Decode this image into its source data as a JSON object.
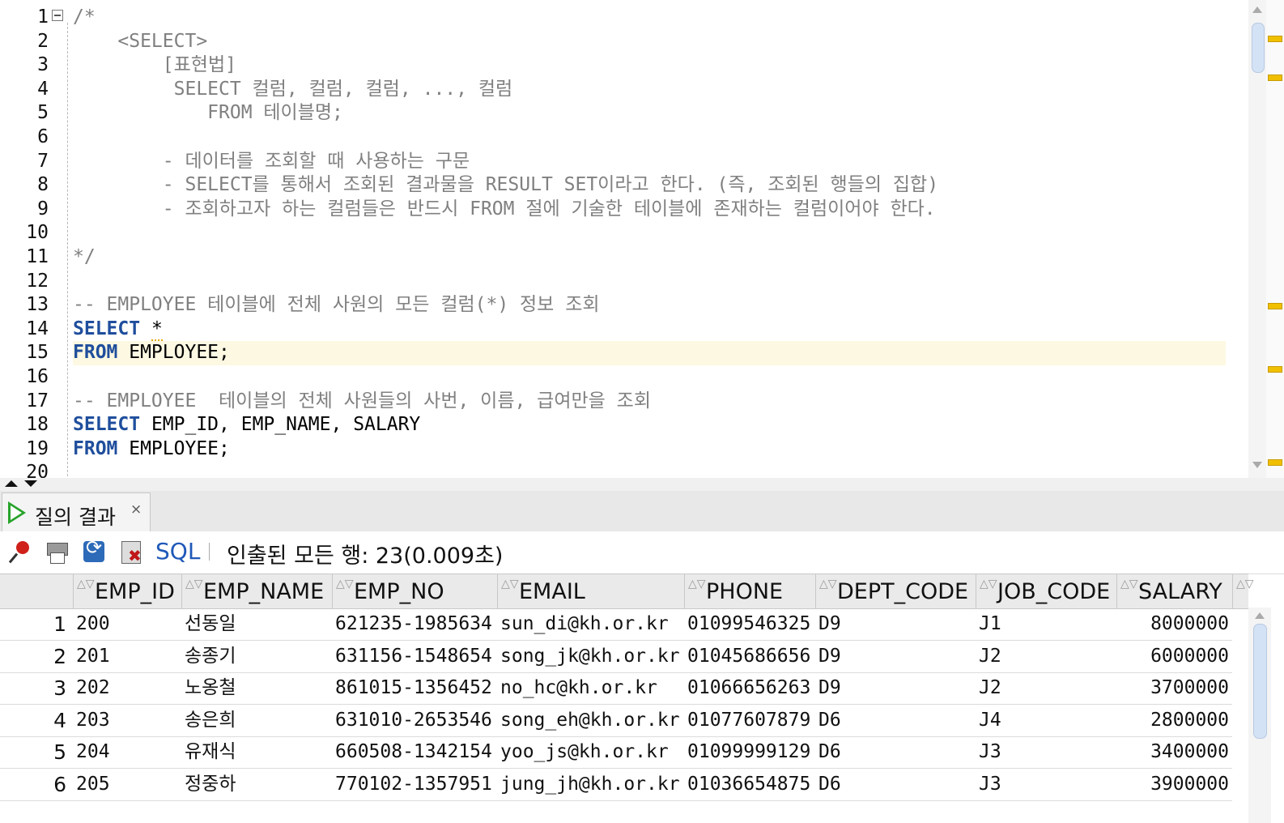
{
  "editor": {
    "line_numbers": [
      "1",
      "2",
      "3",
      "4",
      "5",
      "6",
      "7",
      "8",
      "9",
      "10",
      "11",
      "12",
      "13",
      "14",
      "15",
      "16",
      "17",
      "18",
      "19",
      "20"
    ],
    "lines": [
      [
        {
          "t": "/*",
          "c": "cm"
        }
      ],
      [
        {
          "t": "    <SELECT>",
          "c": "cm"
        }
      ],
      [
        {
          "t": "        [표현법]",
          "c": "cm"
        }
      ],
      [
        {
          "t": "         SELECT 컬럼, 컬럼, 컬럼, ..., 컬럼",
          "c": "cm"
        }
      ],
      [
        {
          "t": "            FROM 테이블명;",
          "c": "cm"
        }
      ],
      [],
      [
        {
          "t": "        - 데이터를 조회할 때 사용하는 구문",
          "c": "cm"
        }
      ],
      [
        {
          "t": "        - SELECT를 통해서 조회된 결과물을 RESULT SET이라고 한다. (즉, 조회된 행들의 집합)",
          "c": "cm"
        }
      ],
      [
        {
          "t": "        - 조회하고자 하는 컬럼들은 반드시 FROM 절에 기술한 테이블에 존재하는 컬럼이어야 한다.",
          "c": "cm"
        }
      ],
      [],
      [
        {
          "t": "*/",
          "c": "cm"
        }
      ],
      [],
      [
        {
          "t": "-- EMPLOYEE 테이블에 전체 사원의 모든 컬럼(*) 정보 조회",
          "c": "cm"
        }
      ],
      [
        {
          "t": "SELECT",
          "c": "kw"
        },
        {
          "t": " ",
          "c": "plain"
        },
        {
          "t": "*",
          "c": "squig"
        }
      ],
      [
        {
          "t": "FROM",
          "c": "kw"
        },
        {
          "t": " EMPLOYEE;",
          "c": "plain"
        }
      ],
      [],
      [
        {
          "t": "-- EMPLOYEE  테이블의 전체 사원들의 사번, 이름, 급여만을 조회",
          "c": "cm"
        }
      ],
      [
        {
          "t": "SELECT",
          "c": "kw"
        },
        {
          "t": " EMP_ID, EMP_NAME, SALARY",
          "c": "plain"
        }
      ],
      [
        {
          "t": "FROM",
          "c": "kw"
        },
        {
          "t": " EMPLOYEE;",
          "c": "plain"
        }
      ],
      []
    ]
  },
  "results_tab": {
    "label": "질의 결과",
    "close": "×"
  },
  "toolbar": {
    "sql_label": "SQL",
    "status": "인출된 모든 행: 23(0.009초)"
  },
  "grid": {
    "columns": [
      "EMP_ID",
      "EMP_NAME",
      "EMP_NO",
      "EMAIL",
      "PHONE",
      "DEPT_CODE",
      "JOB_CODE",
      "SALARY"
    ],
    "rows": [
      [
        "1",
        "200",
        "선동일",
        "621235-1985634",
        "sun_di@kh.or.kr",
        "01099546325",
        "D9",
        "J1",
        "8000000"
      ],
      [
        "2",
        "201",
        "송종기",
        "631156-1548654",
        "song_jk@kh.or.kr",
        "01045686656",
        "D9",
        "J2",
        "6000000"
      ],
      [
        "3",
        "202",
        "노옹철",
        "861015-1356452",
        "no_hc@kh.or.kr",
        "01066656263",
        "D9",
        "J2",
        "3700000"
      ],
      [
        "4",
        "203",
        "송은희",
        "631010-2653546",
        "song_eh@kh.or.kr",
        "01077607879",
        "D6",
        "J4",
        "2800000"
      ],
      [
        "5",
        "204",
        "유재식",
        "660508-1342154",
        "yoo_js@kh.or.kr",
        "01099999129",
        "D6",
        "J3",
        "3400000"
      ],
      [
        "6",
        "205",
        "정중하",
        "770102-1357951",
        "jung_jh@kh.or.kr",
        "01036654875",
        "D6",
        "J3",
        "3900000"
      ]
    ]
  },
  "colors": {
    "keyword": "#1f4e9c",
    "comment": "#808080",
    "current_line": "#fdf8e2",
    "run_icon": "#27a32a",
    "sql_link": "#1f59b8"
  }
}
